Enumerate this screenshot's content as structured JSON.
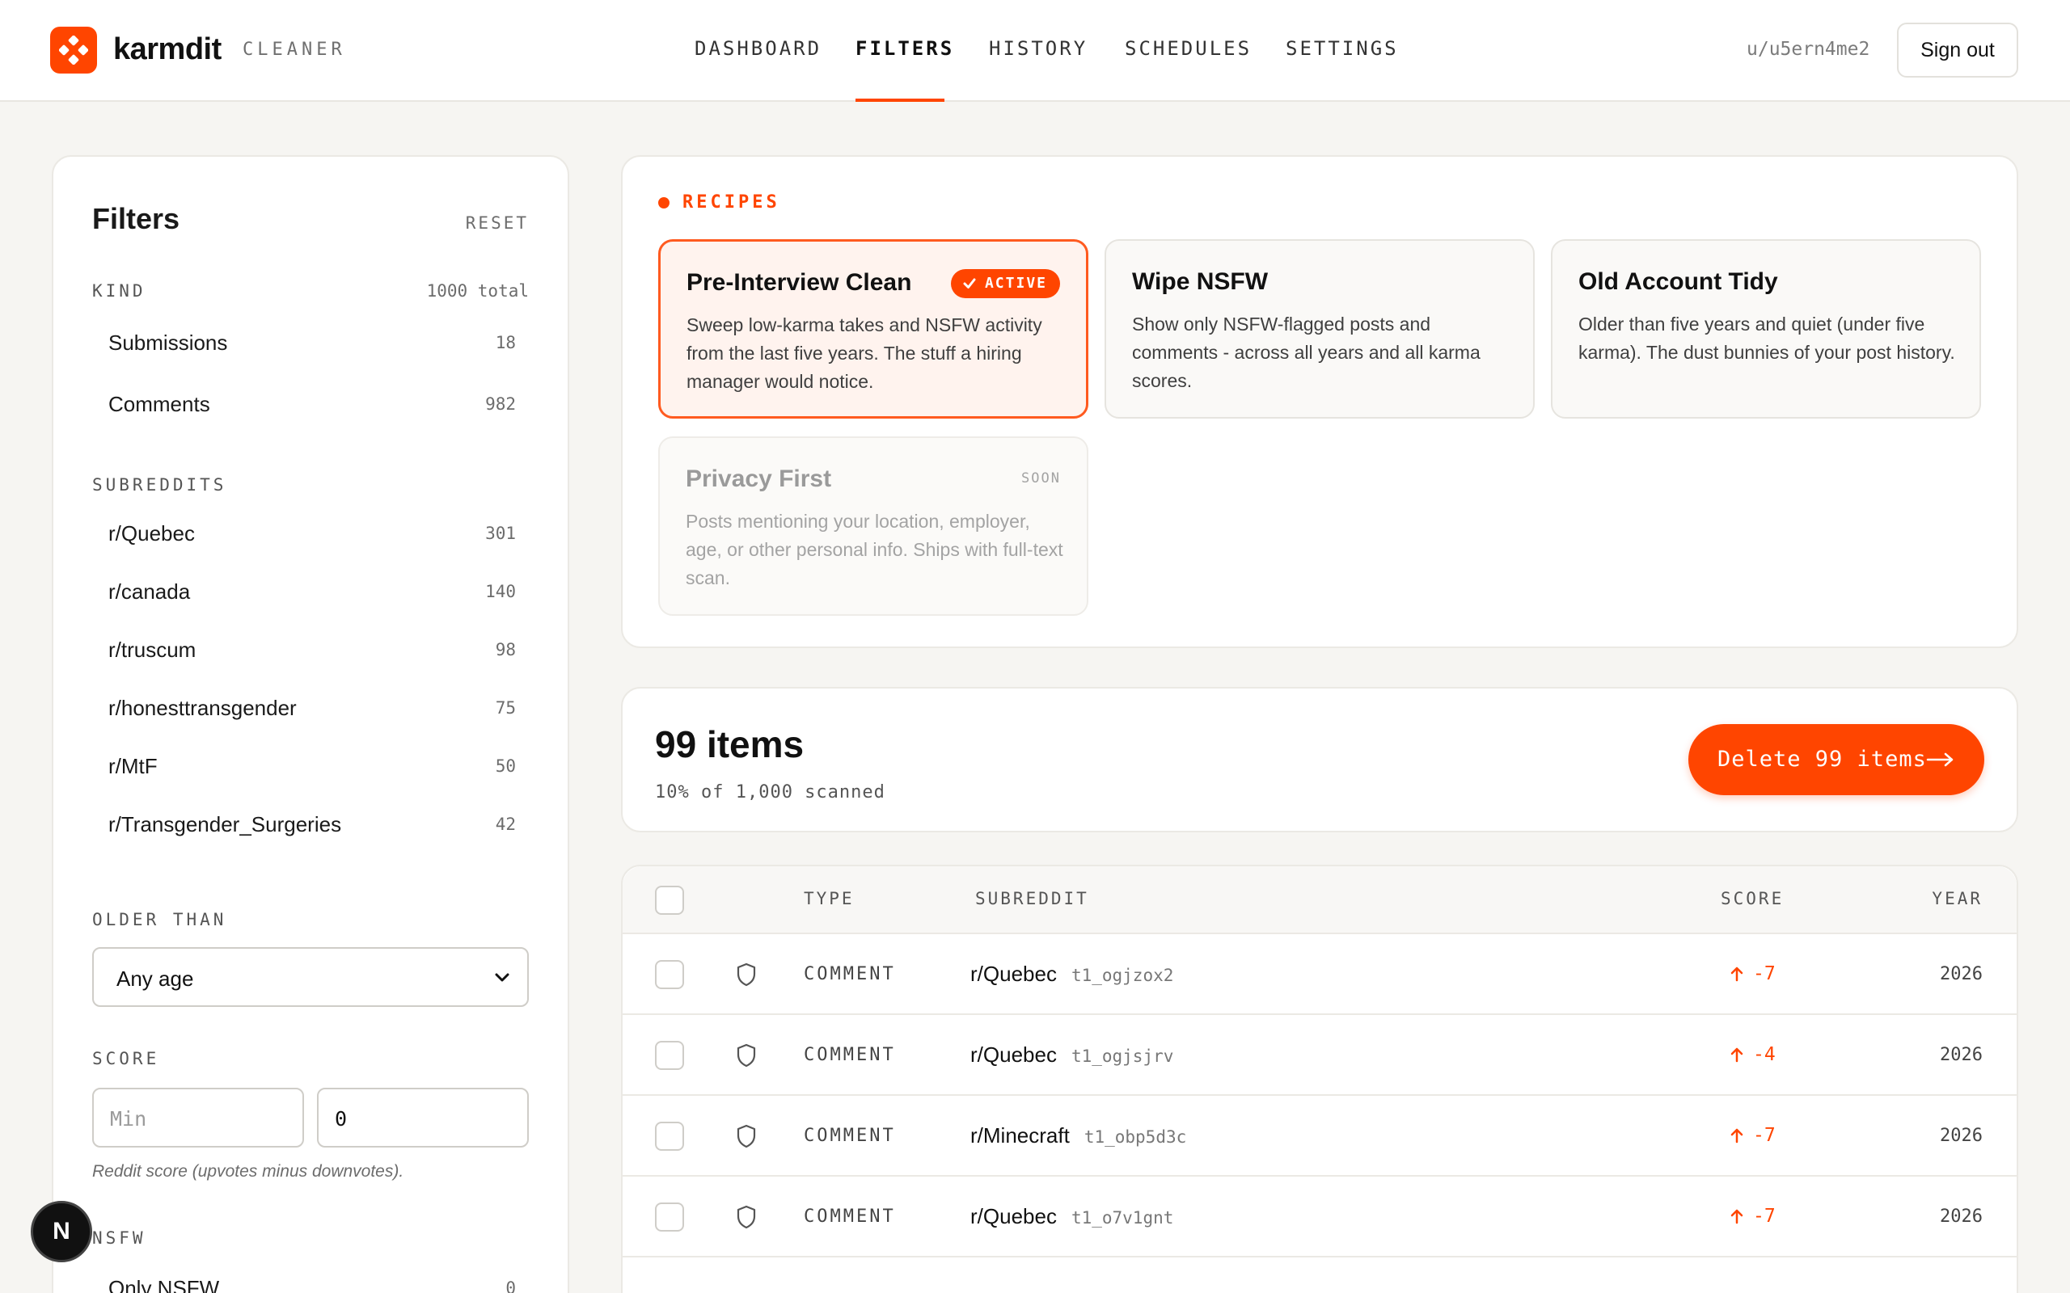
{
  "header": {
    "brand": "karmdit",
    "brand_sub": "CLEANER",
    "nav": [
      {
        "label": "DASHBOARD"
      },
      {
        "label": "FILTERS"
      },
      {
        "label": "HISTORY"
      },
      {
        "label": "SCHEDULES"
      },
      {
        "label": "SETTINGS"
      }
    ],
    "active_nav": "FILTERS",
    "username": "u/u5ern4me2",
    "signout_label": "Sign out"
  },
  "sidebar": {
    "title": "Filters",
    "reset_label": "RESET",
    "kind": {
      "label": "KIND",
      "total": "1000 total",
      "items": [
        {
          "label": "Submissions",
          "count": "18"
        },
        {
          "label": "Comments",
          "count": "982"
        }
      ]
    },
    "subreddits": {
      "label": "SUBREDDITS",
      "items": [
        {
          "label": "r/Quebec",
          "count": "301"
        },
        {
          "label": "r/canada",
          "count": "140"
        },
        {
          "label": "r/truscum",
          "count": "98"
        },
        {
          "label": "r/honesttransgender",
          "count": "75"
        },
        {
          "label": "r/MtF",
          "count": "50"
        },
        {
          "label": "r/Transgender_Surgeries",
          "count": "42"
        }
      ]
    },
    "older_than": {
      "label": "OLDER THAN",
      "value": "Any age"
    },
    "score": {
      "label": "SCORE",
      "min_placeholder": "Min",
      "max_value": "0",
      "hint": "Reddit score (upvotes minus downvotes)."
    },
    "nsfw": {
      "label": "NSFW",
      "items": [
        {
          "label": "Only NSFW",
          "count": "0"
        }
      ]
    }
  },
  "recipes": {
    "label": "RECIPES",
    "items": [
      {
        "title": "Pre-Interview Clean",
        "desc": "Sweep low-karma takes and NSFW activity from the last five years. The stuff a hiring manager would notice.",
        "badge": "ACTIVE"
      },
      {
        "title": "Wipe NSFW",
        "desc": "Show only NSFW-flagged posts and comments - across all years and all karma scores."
      },
      {
        "title": "Old Account Tidy",
        "desc": "Older than five years and quiet (under five karma). The dust bunnies of your post history."
      },
      {
        "title": "Privacy First",
        "desc": "Posts mentioning your location, employer, age, or other personal info. Ships with full-text scan.",
        "badge": "SOON"
      }
    ]
  },
  "summary": {
    "title": "99 items",
    "subtitle": "10% of 1,000 scanned",
    "delete_label": "Delete 99 items"
  },
  "table": {
    "headers": {
      "type": "TYPE",
      "subreddit": "SUBREDDIT",
      "score": "SCORE",
      "year": "YEAR"
    },
    "rows": [
      {
        "type": "COMMENT",
        "subreddit": "r/Quebec",
        "id": "t1_ogjzox2",
        "score": "-7",
        "year": "2026"
      },
      {
        "type": "COMMENT",
        "subreddit": "r/Quebec",
        "id": "t1_ogjsjrv",
        "score": "-4",
        "year": "2026"
      },
      {
        "type": "COMMENT",
        "subreddit": "r/Minecraft",
        "id": "t1_obp5d3c",
        "score": "-7",
        "year": "2026"
      },
      {
        "type": "COMMENT",
        "subreddit": "r/Quebec",
        "id": "t1_o7v1gnt",
        "score": "-7",
        "year": "2026"
      }
    ]
  },
  "dev_badge": "N",
  "colors": {
    "accent": "#ff4500",
    "background": "#f6f5f2"
  }
}
